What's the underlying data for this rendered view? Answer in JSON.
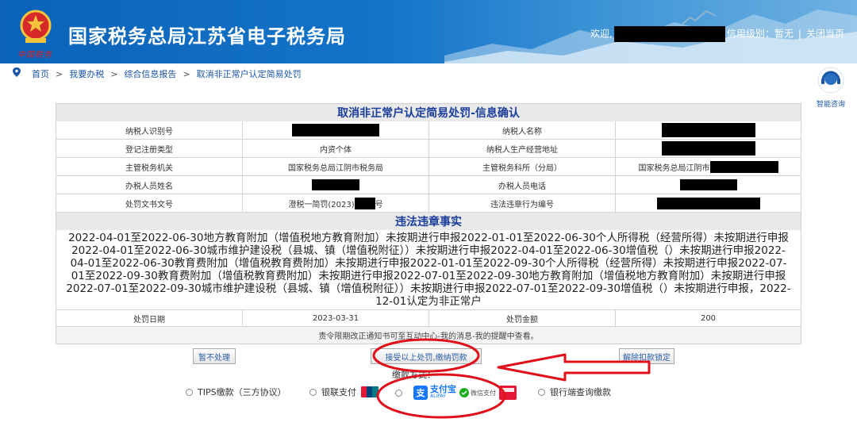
{
  "header": {
    "site_title": "国家税务总局江苏省电子税务局",
    "brand_script": "中国税务",
    "welcome": "欢迎,",
    "credit_level": "信用级别：暂无",
    "close_page": "关闭当页"
  },
  "breadcrumb": {
    "items": [
      "首页",
      "我要办税",
      "综合信息报告",
      "取消非正常户认定简易处罚"
    ]
  },
  "assist": {
    "label": "智能咨询"
  },
  "form": {
    "title": "取消非正常户认定简易处罚-信息确认",
    "fields": {
      "taxpayer_id_label": "纳税人识别号",
      "taxpayer_name_label": "纳税人名称",
      "reg_type_label": "登记注册类型",
      "reg_type_value": "内资个体",
      "address_label": "纳税人生产经营地址",
      "tax_authority_label": "主管税务机关",
      "tax_authority_value": "国家税务总局江阴市税务局",
      "tax_branch_label": "主管税务科所（分局）",
      "tax_branch_value": "国家税务总局江阴市",
      "handler_name_label": "办税人员姓名",
      "handler_phone_label": "办税人员电话",
      "penalty_doc_label": "处罚文书文号",
      "penalty_doc_value_prefix": "澄税一简罚(2023)",
      "penalty_doc_value_suffix": "号",
      "violation_no_label": "违法违章行为编号"
    },
    "violation_title": "违法违章事实",
    "violation_text": "2022-04-01至2022-06-30地方教育附加（增值税地方教育附加）未按期进行申报2022-01-01至2022-06-30个人所得税（经营所得）未按期进行申报2022-04-01至2022-06-30城市维护建设税（县城、镇（增值税附征））未按期进行申报2022-04-01至2022-06-30增值税（）未按期进行申报2022-04-01至2022-06-30教育费附加（增值税教育费附加）未按期进行申报2022-01-01至2022-09-30个人所得税（经营所得）未按期进行申报2022-07-01至2022-09-30教育费附加（增值税教育费附加）未按期进行申报2022-07-01至2022-09-30地方教育附加（增值税地方教育附加）未按期进行申报2022-07-01至2022-09-30城市维护建设税（县城、镇（增值税附征））未按期进行申报2022-07-01至2022-09-30增值税（）未按期进行申报，2022-12-01认定为非正常户",
    "penalty_date_label": "处罚日期",
    "penalty_date_value": "2023-03-31",
    "penalty_amount_label": "处罚金额",
    "penalty_amount_value": "200",
    "notice": "责令限期改正通知书可至互动中心-我的消息-我的提醒中查看。"
  },
  "buttons": {
    "skip": "暂不处理",
    "accept": "接受以上处罚,缴纳罚款",
    "unlock": "解除扣款锁定"
  },
  "payment": {
    "label": "缴款方式：",
    "options": [
      "TIPS缴款（三方协议）",
      "银联支付",
      "银行端查询缴款"
    ],
    "alipay_text": "支付宝",
    "alipay_sub": "ALIPAY",
    "wechat_text": "微信支付"
  },
  "annotation_colors": {
    "highlight": "#e0101a"
  }
}
